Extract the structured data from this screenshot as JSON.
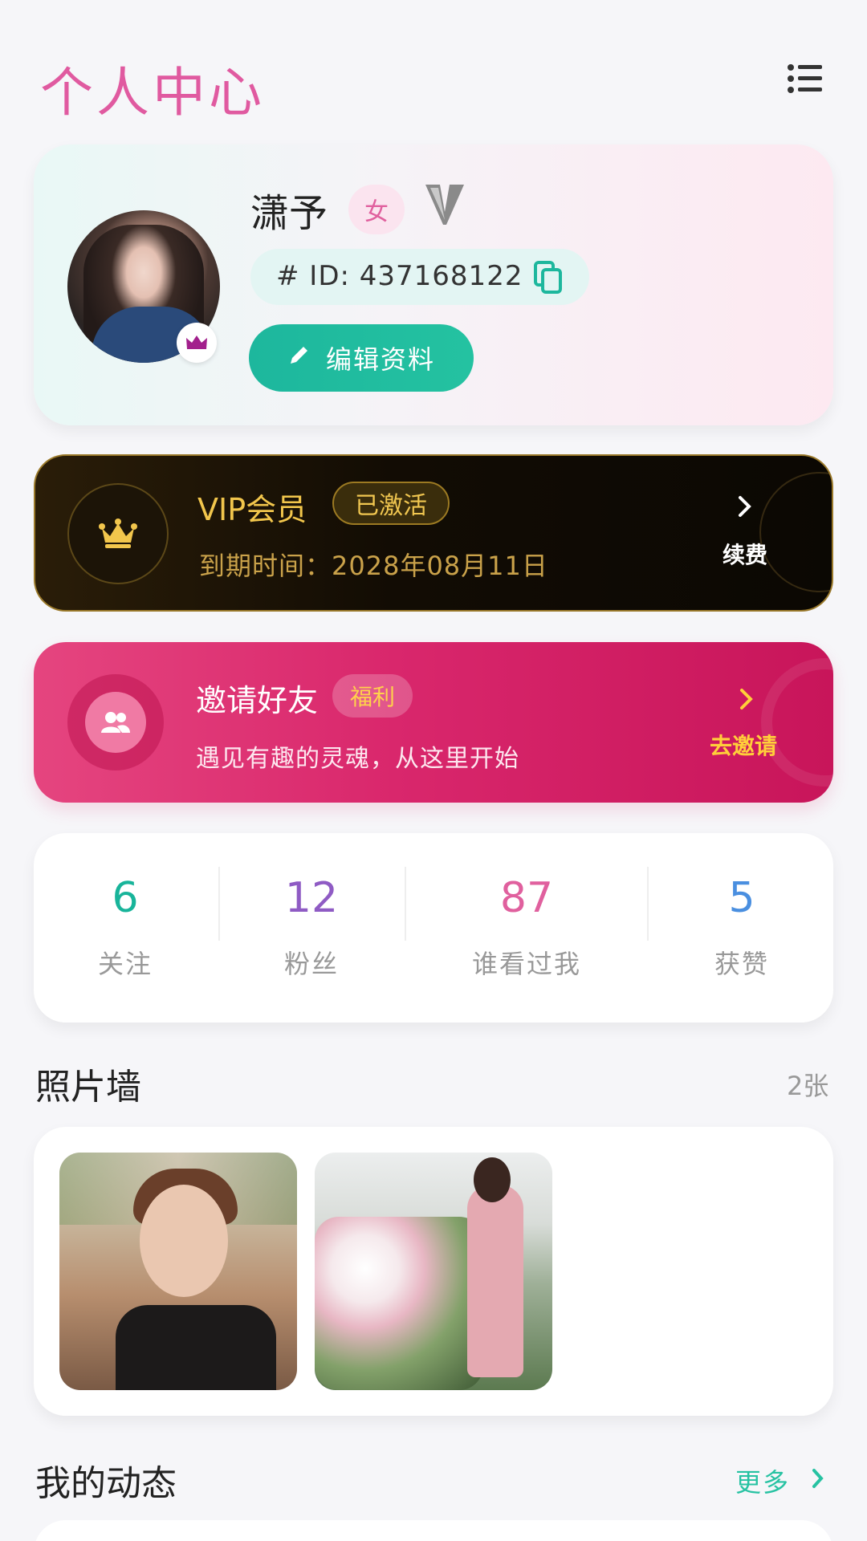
{
  "header": {
    "title": "个人中心",
    "menu_icon": "list-menu-icon"
  },
  "profile": {
    "nickname": "潇予",
    "gender": "女",
    "id_text": "# ID: 437168122",
    "edit_label": "编辑资料",
    "colors": {
      "accent": "#e05aa0",
      "teal": "#1db79d"
    }
  },
  "vip": {
    "title": "VIP会员",
    "status": "已激活",
    "expire": "到期时间：2028年08月11日",
    "renew": "续费",
    "colors": {
      "gold": "#f2c64c"
    }
  },
  "invite": {
    "title": "邀请好友",
    "tag": "福利",
    "subtitle": "遇见有趣的灵魂，从这里开始",
    "action": "去邀请"
  },
  "stats": [
    {
      "value": "6",
      "label": "关注",
      "color": "#18b49a"
    },
    {
      "value": "12",
      "label": "粉丝",
      "color": "#8f5bc4"
    },
    {
      "value": "87",
      "label": "谁看过我",
      "color": "#e0609e"
    },
    {
      "value": "5",
      "label": "获赞",
      "color": "#4a8fe0"
    }
  ],
  "photos": {
    "title": "照片墙",
    "count": "2张"
  },
  "moments": {
    "title": "我的动态",
    "more": "更多"
  }
}
